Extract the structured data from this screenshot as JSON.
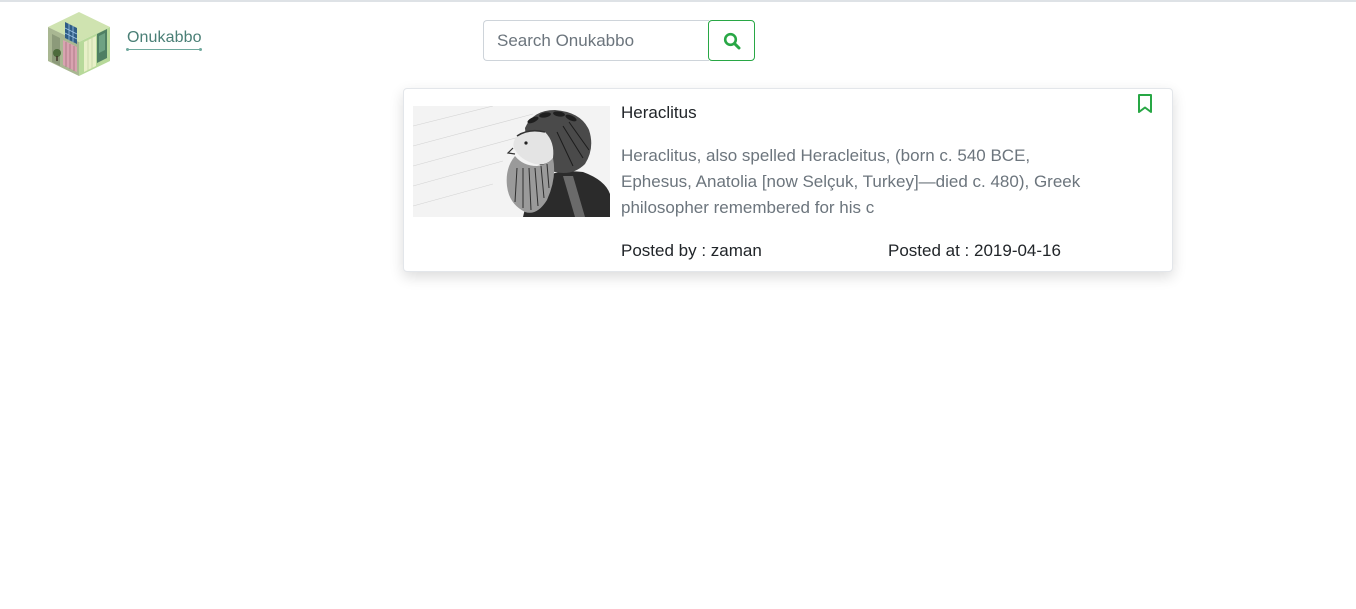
{
  "brand": {
    "name": "Onukabbo",
    "logo_icon": "building-cube-logo"
  },
  "search": {
    "placeholder": "Search Onukabbo",
    "value": "",
    "button_icon": "search-icon"
  },
  "colors": {
    "accent": "#28a745",
    "brand_text": "#4a7f76",
    "muted_text": "#6c757d"
  },
  "posts": [
    {
      "title": "Heraclitus",
      "excerpt": "Heraclitus, also spelled Heracleitus, (born c. 540 BCE, Ephesus, Anatolia [now Selçuk, Turkey]—died c. 480), Greek philosopher remembered for his c",
      "posted_by": "Posted by : zaman",
      "posted_at": "Posted at : 2019-04-16",
      "image_subject": "engraving-portrait-of-heraclitus",
      "bookmark_icon": "bookmark-icon"
    }
  ]
}
